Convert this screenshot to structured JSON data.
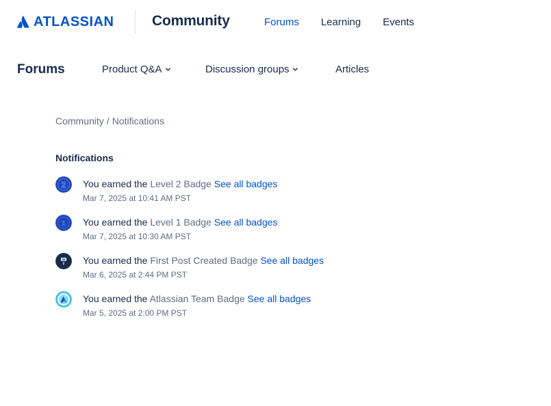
{
  "header": {
    "brand": "ATLASSIAN",
    "product": "Community",
    "nav": [
      {
        "label": "Forums",
        "active": true
      },
      {
        "label": "Learning",
        "active": false
      },
      {
        "label": "Events",
        "active": false
      }
    ]
  },
  "subnav": {
    "title": "Forums",
    "items": [
      {
        "label": "Product Q&A",
        "has_dropdown": true,
        "icon": "chevron-down-icon"
      },
      {
        "label": "Discussion groups",
        "has_dropdown": true,
        "icon": "chevron-down-icon"
      },
      {
        "label": "Articles",
        "has_dropdown": false
      }
    ]
  },
  "breadcrumb": {
    "items": [
      "Community",
      "Notifications"
    ],
    "separator": "/"
  },
  "notifications": {
    "title": "Notifications",
    "items": [
      {
        "prefix": "You earned the",
        "badge": "Level 2 Badge",
        "link": "See all badges",
        "time": "Mar 7, 2025 at 10:41 AM PST",
        "icon": "level-2-badge-icon"
      },
      {
        "prefix": "You earned the",
        "badge": "Level 1 Badge",
        "link": "See all badges",
        "time": "Mar 7, 2025 at 10:30 AM PST",
        "icon": "level-1-badge-icon"
      },
      {
        "prefix": "You earned the",
        "badge": "First Post Created Badge",
        "link": "See all badges",
        "time": "Mar 6, 2025 at 2:44 PM PST",
        "icon": "first-post-badge-icon"
      },
      {
        "prefix": "You earned the",
        "badge": "Atlassian Team Badge",
        "link": "See all badges",
        "time": "Mar 5, 2025 at 2:00 PM PST",
        "icon": "atlassian-team-badge-icon"
      }
    ]
  },
  "colors": {
    "brand_blue": "#0052cc",
    "text_primary": "#172b4d",
    "text_subtle": "#5e6c84"
  }
}
